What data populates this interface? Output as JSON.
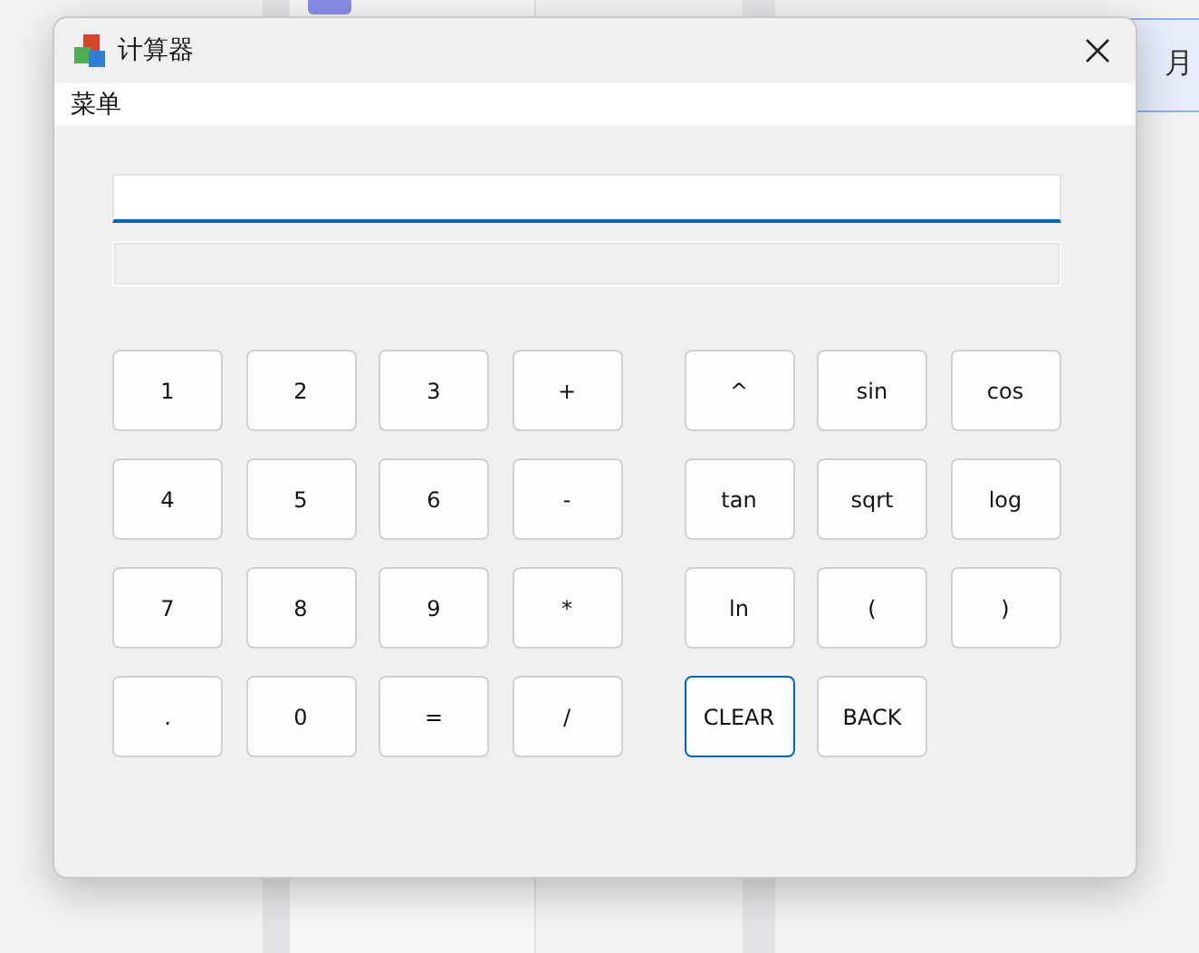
{
  "background": {
    "side_text": "月"
  },
  "window": {
    "title": "计算器"
  },
  "menu": [
    "菜单"
  ],
  "keypads": [
    {
      "keys": [
        {
          "label": "1",
          "focused": false
        },
        {
          "label": "2",
          "focused": false
        },
        {
          "label": "3",
          "focused": false
        },
        {
          "label": "+",
          "focused": false
        },
        {
          "label": "4",
          "focused": false
        },
        {
          "label": "5",
          "focused": false
        },
        {
          "label": "6",
          "focused": false
        },
        {
          "label": "-",
          "focused": false
        },
        {
          "label": "7",
          "focused": false
        },
        {
          "label": "8",
          "focused": false
        },
        {
          "label": "9",
          "focused": false
        },
        {
          "label": "*",
          "focused": false
        },
        {
          "label": ".",
          "focused": false
        },
        {
          "label": "0",
          "focused": false
        },
        {
          "label": "=",
          "focused": false
        },
        {
          "label": "/",
          "focused": false
        }
      ]
    },
    {
      "keys": [
        {
          "label": "^",
          "focused": false
        },
        {
          "label": "sin",
          "focused": false
        },
        {
          "label": "cos",
          "focused": false
        },
        {
          "label": "tan",
          "focused": false
        },
        {
          "label": "sqrt",
          "focused": false
        },
        {
          "label": "log",
          "focused": false
        },
        {
          "label": "ln",
          "focused": false
        },
        {
          "label": "(",
          "focused": false
        },
        {
          "label": ")",
          "focused": false
        },
        {
          "label": "CLEAR",
          "focused": true
        },
        {
          "label": "BACK",
          "focused": false
        }
      ]
    }
  ]
}
